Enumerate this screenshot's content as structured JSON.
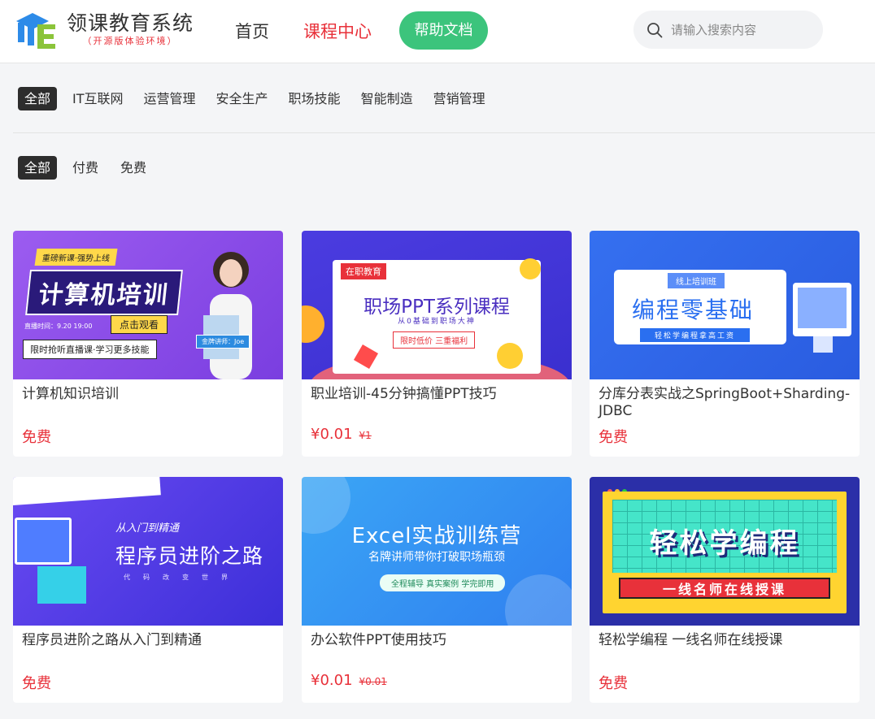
{
  "header": {
    "logo_title": "领课教育系统",
    "logo_subtitle": "（开源版体验环境）",
    "nav": [
      {
        "label": "首页",
        "active": false
      },
      {
        "label": "课程中心",
        "active": true
      }
    ],
    "help_button": "帮助文档",
    "search_placeholder": "请输入搜索内容"
  },
  "filters": {
    "categories": [
      {
        "label": "全部",
        "active": true
      },
      {
        "label": "IT互联网",
        "active": false
      },
      {
        "label": "运营管理",
        "active": false
      },
      {
        "label": "安全生产",
        "active": false
      },
      {
        "label": "职场技能",
        "active": false
      },
      {
        "label": "智能制造",
        "active": false
      },
      {
        "label": "营销管理",
        "active": false
      }
    ],
    "pricing": [
      {
        "label": "全部",
        "active": true
      },
      {
        "label": "付费",
        "active": false
      },
      {
        "label": "免费",
        "active": false
      }
    ]
  },
  "courses": [
    {
      "title": "计算机知识培训",
      "price": "免费",
      "original_price": "",
      "cover": {
        "tag": "重磅新课·强势上线",
        "headline": "计算机培训",
        "watch": "点击观看",
        "time": "直播时间：9.20 19:00",
        "limit": "限时抢听直播课·学习更多技能",
        "teacher": "金牌讲师：Joe"
      }
    },
    {
      "title": "职业培训-45分钟搞懂PPT技巧",
      "price": "¥0.01",
      "original_price": "¥1",
      "cover": {
        "tag": "在职教育",
        "headline": "职场PPT系列课程",
        "sub": "从0基础到职场大神",
        "badge": "限时低价  三重福利"
      }
    },
    {
      "title": "分库分表实战之SpringBoot+Sharding-JDBC",
      "price": "免费",
      "original_price": "",
      "cover": {
        "tag": "线上培训班",
        "headline": "编程零基础",
        "sub": "轻松学编程拿高工资"
      }
    },
    {
      "title": "程序员进阶之路从入门到精通",
      "price": "免费",
      "original_price": "",
      "cover": {
        "from": "从入门到精通",
        "headline": "程序员进阶之路",
        "sub": "代码改变世界"
      }
    },
    {
      "title": "办公软件PPT使用技巧",
      "price": "¥0.01",
      "original_price": "¥0.01",
      "cover": {
        "headline": "Excel实战训练营",
        "sub": "名牌讲师带你打破职场瓶颈",
        "pill": "全程辅导 真实案例 学完即用"
      }
    },
    {
      "title": "轻松学编程 一线名师在线授课",
      "price": "免费",
      "original_price": "",
      "cover": {
        "headline": "轻松学编程",
        "sub": "一线名师在线授课"
      }
    }
  ],
  "colors": {
    "accent": "#e8313a",
    "help_button": "#3cc47c",
    "active_chip": "#2d2d2d"
  },
  "icons": {
    "search": "search-icon",
    "logo": "logo-icon"
  }
}
